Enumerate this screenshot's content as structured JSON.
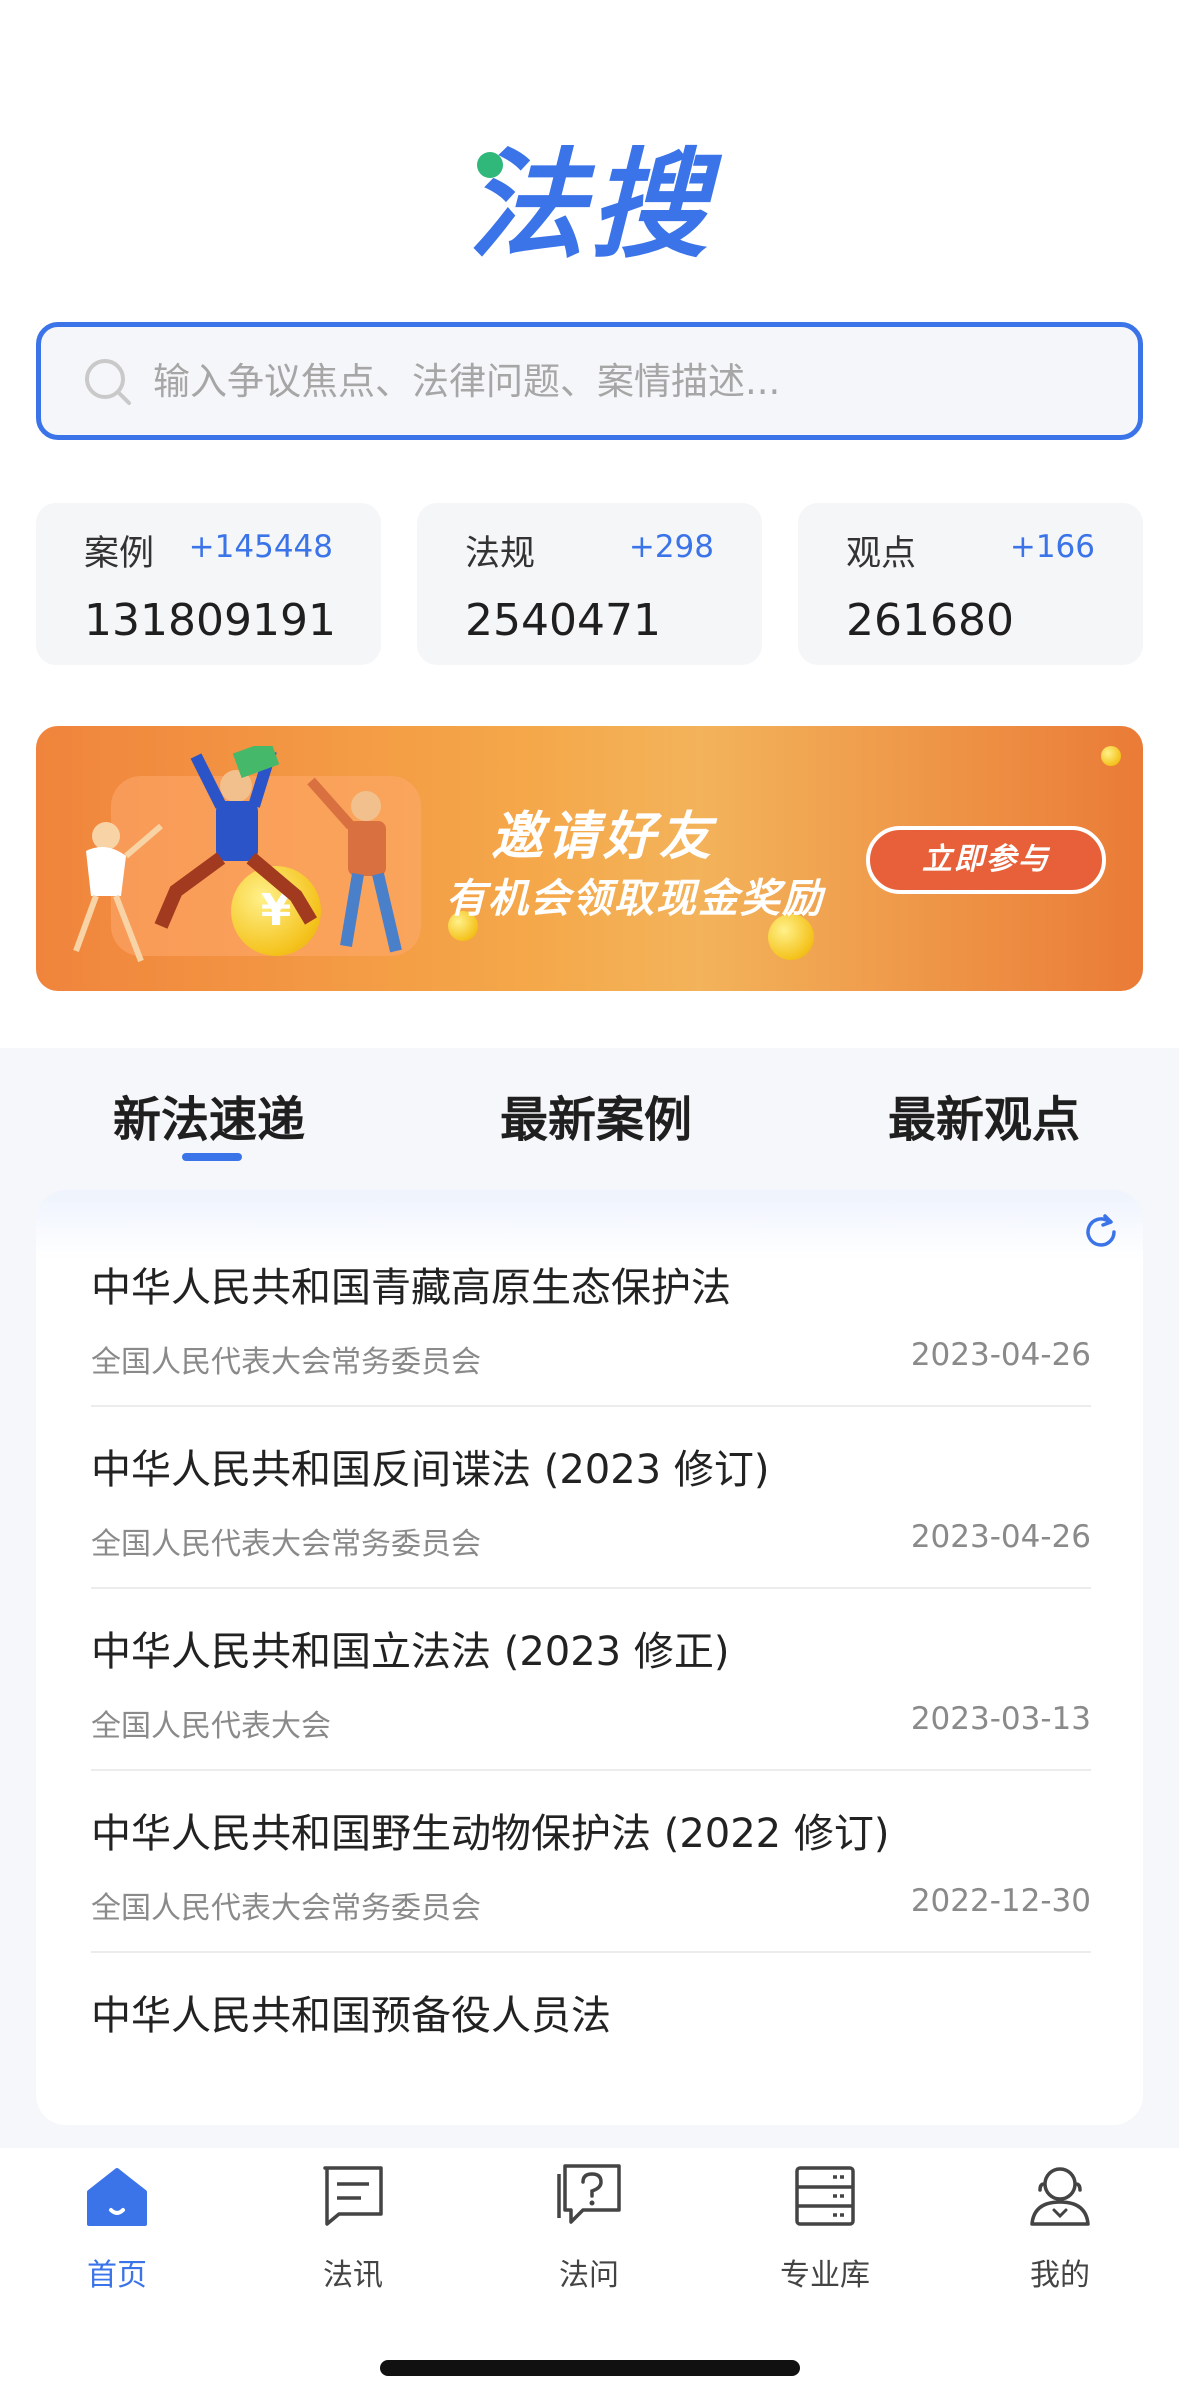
{
  "app": {
    "logo_text": "法搜"
  },
  "search": {
    "placeholder": "输入争议焦点、法律问题、案情描述..."
  },
  "stats": [
    {
      "label": "案例",
      "delta": "+145448",
      "value": "131809191"
    },
    {
      "label": "法规",
      "delta": "+298",
      "value": "2540471"
    },
    {
      "label": "观点",
      "delta": "+166",
      "value": "261680"
    }
  ],
  "banner": {
    "title": "邀请好友",
    "subtitle": "有机会领取现金奖励",
    "button": "立即参与",
    "coin_symbol": "¥"
  },
  "tabs": [
    {
      "label": "新法速递",
      "active": true
    },
    {
      "label": "最新案例",
      "active": false
    },
    {
      "label": "最新观点",
      "active": false
    }
  ],
  "list": [
    {
      "title": "中华人民共和国青藏高原生态保护法",
      "org": "全国人民代表大会常务委员会",
      "date": "2023-04-26"
    },
    {
      "title": "中华人民共和国反间谍法 (2023 修订)",
      "org": "全国人民代表大会常务委员会",
      "date": "2023-04-26"
    },
    {
      "title": "中华人民共和国立法法 (2023 修正)",
      "org": "全国人民代表大会",
      "date": "2023-03-13"
    },
    {
      "title": "中华人民共和国野生动物保护法 (2022 修订)",
      "org": "全国人民代表大会常务委员会",
      "date": "2022-12-30"
    },
    {
      "title": "中华人民共和国预备役人员法",
      "org": "",
      "date": ""
    }
  ],
  "nav": [
    {
      "label": "首页",
      "icon": "home-icon",
      "active": true
    },
    {
      "label": "法讯",
      "icon": "news-icon",
      "active": false
    },
    {
      "label": "法问",
      "icon": "question-icon",
      "active": false
    },
    {
      "label": "专业库",
      "icon": "database-icon",
      "active": false
    },
    {
      "label": "我的",
      "icon": "profile-icon",
      "active": false
    }
  ],
  "colors": {
    "brand": "#3b74e8",
    "logo_dot": "#2fb87a",
    "banner_orange": "#f0843c"
  }
}
